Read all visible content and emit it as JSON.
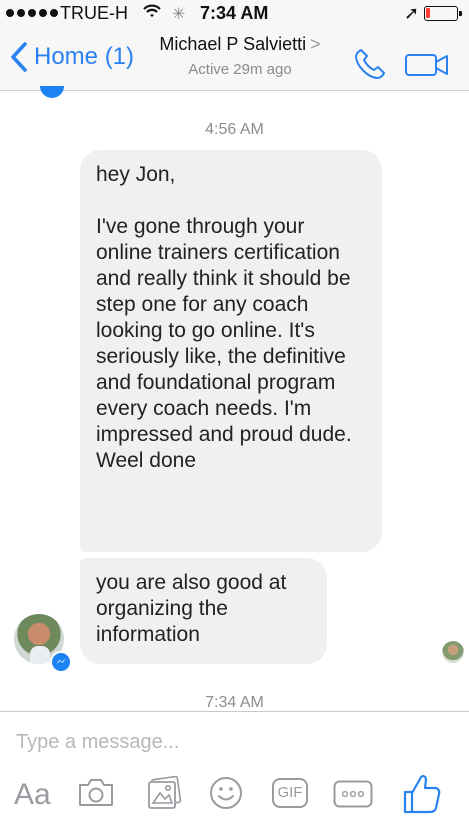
{
  "status_bar": {
    "carrier": "TRUE-H",
    "time": "7:34 AM",
    "battery_level": 0.15
  },
  "nav": {
    "back_label": "Home (1)",
    "contact_name": "Michael P Salvietti",
    "contact_status": "Active 29m ago"
  },
  "thread": {
    "timestamp_1": "4:56 AM",
    "message_1": "hey Jon,\n\nI've gone through your online trainers certification and really think it should be step one for any coach looking to go online. It's seriously like, the definitive and foundational program every coach needs. I'm impressed and proud dude. Weel done",
    "message_2": "you are also good at organizing the information",
    "timestamp_2": "7:34 AM"
  },
  "compose": {
    "placeholder": "Type a message...",
    "text_button_label": "Aa",
    "gif_label": "GIF"
  },
  "colors": {
    "accent": "#2a82f0",
    "bubble": "#f0f0f1",
    "bar_bg": "#f7f7f8"
  }
}
